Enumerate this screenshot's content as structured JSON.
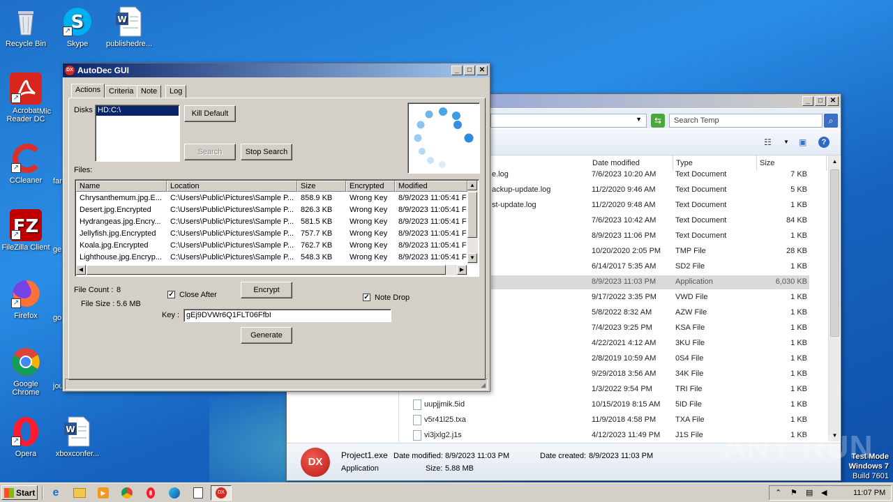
{
  "desktop": {
    "icons": [
      {
        "label": "Recycle Bin"
      },
      {
        "label": "Skype"
      },
      {
        "label": "publishedre..."
      },
      {
        "label": "Acrobat Reader DC"
      },
      {
        "label": "Mic"
      },
      {
        "label": "CCleaner"
      },
      {
        "label": "far"
      },
      {
        "label": "FileZilla Client"
      },
      {
        "label": "ge"
      },
      {
        "label": "Firefox"
      },
      {
        "label": "go"
      },
      {
        "label": "Google Chrome"
      },
      {
        "label": "jou"
      },
      {
        "label": "Opera"
      },
      {
        "label": "xboxconfer..."
      }
    ],
    "watermark": "ANY RUN",
    "os_info": {
      "line1": "Test Mode",
      "line2": "Windows 7",
      "line3": "Build 7601"
    }
  },
  "autodec": {
    "title": "AutoDec GUI",
    "tabs": [
      "Actions",
      "Criteria",
      "Note",
      "Log"
    ],
    "disks_label": "Disks",
    "disk_item": "HD:C:\\",
    "buttons": {
      "kill_default": "Kill Default",
      "search": "Search",
      "stop_search": "Stop Search",
      "encrypt": "Encrypt",
      "generate": "Generate"
    },
    "files_label": "Files:",
    "columns": [
      "Name",
      "Location",
      "Size",
      "Encrypted",
      "Modified"
    ],
    "rows": [
      [
        "Chrysanthemum.jpg.E...",
        "C:\\Users\\Public\\Pictures\\Sample P...",
        "858.9 KB",
        "Wrong Key",
        "8/9/2023 11:05:41 F"
      ],
      [
        "Desert.jpg.Encrypted",
        "C:\\Users\\Public\\Pictures\\Sample P...",
        "826.3 KB",
        "Wrong Key",
        "8/9/2023 11:05:41 F"
      ],
      [
        "Hydrangeas.jpg.Encry...",
        "C:\\Users\\Public\\Pictures\\Sample P...",
        "581.5 KB",
        "Wrong Key",
        "8/9/2023 11:05:41 F"
      ],
      [
        "Jellyfish.jpg.Encrypted",
        "C:\\Users\\Public\\Pictures\\Sample P...",
        "757.7 KB",
        "Wrong Key",
        "8/9/2023 11:05:41 F"
      ],
      [
        "Koala.jpg.Encrypted",
        "C:\\Users\\Public\\Pictures\\Sample P...",
        "762.7 KB",
        "Wrong Key",
        "8/9/2023 11:05:41 F"
      ],
      [
        "Lighthouse.jpg.Encryp...",
        "C:\\Users\\Public\\Pictures\\Sample P...",
        "548.3 KB",
        "Wrong Key",
        "8/9/2023 11:05:41 F"
      ]
    ],
    "file_count_label": "File Count :",
    "file_count": "8",
    "file_size_label": "File Size :",
    "file_size": "5.6 MB",
    "close_after_label": "Close After",
    "note_drop_label": "Note Drop",
    "key_label": "Key :",
    "key_value": "gEj9DVWr6Q1FLT06FfbI"
  },
  "explorer": {
    "search_placeholder": "Search Temp",
    "columns": [
      "Date modified",
      "Type",
      "Size"
    ],
    "rows": [
      {
        "name": "e.log",
        "date": "7/6/2023 10:20 AM",
        "type": "Text Document",
        "size": "7 KB"
      },
      {
        "name": "ackup-update.log",
        "date": "11/2/2020 9:46 AM",
        "type": "Text Document",
        "size": "5 KB"
      },
      {
        "name": "st-update.log",
        "date": "11/2/2020 9:48 AM",
        "type": "Text Document",
        "size": "1 KB"
      },
      {
        "name": "",
        "date": "7/6/2023 10:42 AM",
        "type": "Text Document",
        "size": "84 KB"
      },
      {
        "name": "",
        "date": "8/9/2023 11:06 PM",
        "type": "Text Document",
        "size": "1 KB"
      },
      {
        "name": "",
        "date": "10/20/2020 2:05 PM",
        "type": "TMP File",
        "size": "28 KB"
      },
      {
        "name": "",
        "date": "6/14/2017 5:35 AM",
        "type": "SD2 File",
        "size": "1 KB"
      },
      {
        "name": "",
        "date": "8/9/2023 11:03 PM",
        "type": "Application",
        "size": "6,030 KB"
      },
      {
        "name": "",
        "date": "9/17/2022 3:35 PM",
        "type": "VWD File",
        "size": "1 KB"
      },
      {
        "name": "",
        "date": "5/8/2022 8:32 AM",
        "type": "AZW File",
        "size": "1 KB"
      },
      {
        "name": "",
        "date": "7/4/2023 9:25 PM",
        "type": "KSA File",
        "size": "1 KB"
      },
      {
        "name": "",
        "date": "4/22/2021 4:12 AM",
        "type": "3KU File",
        "size": "1 KB"
      },
      {
        "name": "",
        "date": "2/8/2019 10:59 AM",
        "type": "0S4 File",
        "size": "1 KB"
      },
      {
        "name": "",
        "date": "9/29/2018 3:56 AM",
        "type": "34K File",
        "size": "1 KB"
      },
      {
        "name": "",
        "date": "1/3/2022 9:54 PM",
        "type": "TRI File",
        "size": "1 KB"
      },
      {
        "name": "uupjjmik.5id",
        "date": "10/15/2019 8:15 AM",
        "type": "5ID File",
        "size": "1 KB"
      },
      {
        "name": "v5r41l25.txa",
        "date": "11/9/2018 4:58 PM",
        "type": "TXA File",
        "size": "1 KB"
      },
      {
        "name": "vi3jxlg2.j1s",
        "date": "4/12/2023 11:49 PM",
        "type": "J1S File",
        "size": "1 KB"
      }
    ],
    "details": {
      "name": "Project1.exe",
      "type": "Application",
      "modified_label": "Date modified:",
      "modified": "8/9/2023 11:03 PM",
      "created_label": "Date created:",
      "created": "8/9/2023 11:03 PM",
      "size_label": "Size:",
      "size": "5.88 MB",
      "logo_text": "DX"
    }
  },
  "taskbar": {
    "start_label": "Start",
    "clock": "11:07 PM"
  }
}
